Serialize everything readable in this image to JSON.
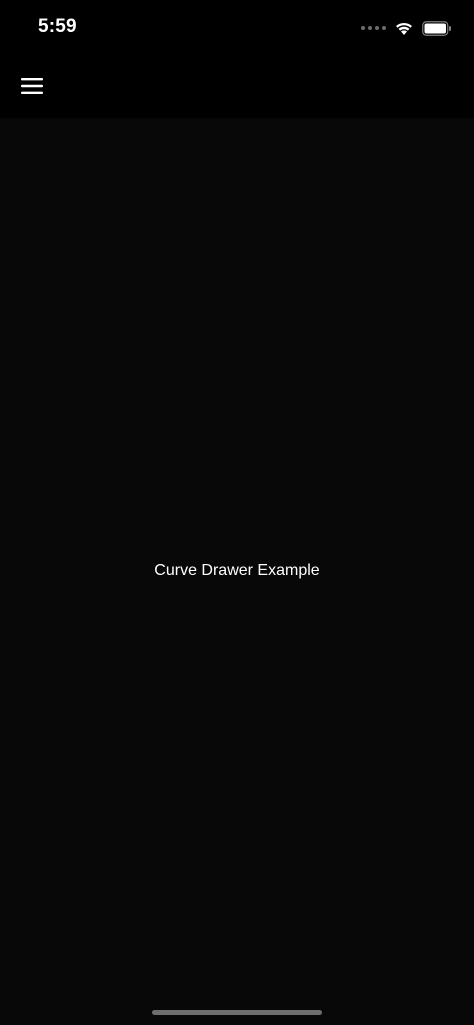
{
  "status_bar": {
    "time": "5:59",
    "icons": [
      "signal-dots-icon",
      "wifi-icon",
      "battery-icon"
    ]
  },
  "app_bar": {
    "menu_icon": "hamburger-menu-icon"
  },
  "main": {
    "title": "Curve Drawer Example"
  },
  "colors": {
    "background": "#080808",
    "app_bar": "#000000",
    "text": "#ffffff"
  }
}
